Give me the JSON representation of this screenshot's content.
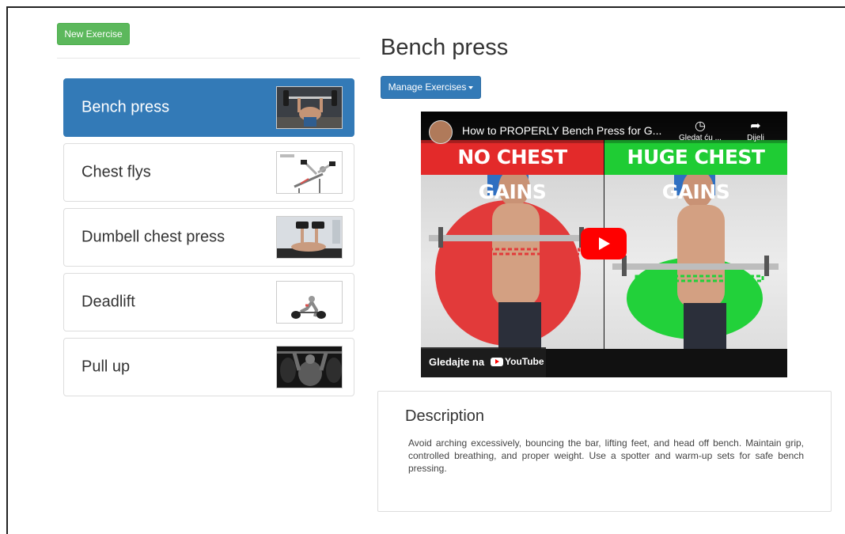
{
  "toolbar": {
    "new_exercise_label": "New Exercise"
  },
  "exercises": [
    {
      "label": "Bench press",
      "active": true,
      "thumb": "bench-press-thumbnail"
    },
    {
      "label": "Chest flys",
      "active": false,
      "thumb": "chest-flys-thumbnail"
    },
    {
      "label": "Dumbell chest press",
      "active": false,
      "thumb": "dumbell-chest-press-thumbnail"
    },
    {
      "label": "Deadlift",
      "active": false,
      "thumb": "deadlift-thumbnail"
    },
    {
      "label": "Pull up",
      "active": false,
      "thumb": "pull-up-thumbnail"
    }
  ],
  "detail": {
    "title": "Bench press",
    "manage_label": "Manage Exercises",
    "video": {
      "title": "How to PROPERLY Bench Press for G...",
      "watch_later": "Gledat ću ...",
      "share": "Dijeli",
      "banner_left": "NO CHEST GAINS",
      "banner_right": "HUGE CHEST GAINS",
      "watch_on": "Gledajte na",
      "platform": "YouTube"
    },
    "description_heading": "Description",
    "description_text": "Avoid arching excessively, bouncing the bar, lifting feet, and head off bench. Maintain grip, controlled breathing, and proper weight. Use a spotter and warm-up sets for safe bench pressing."
  },
  "colors": {
    "success": "#5cb85c",
    "primary": "#337ab7",
    "banner_red": "#e32a2a",
    "banner_green": "#1fcc34",
    "play_red": "#ff0000"
  }
}
